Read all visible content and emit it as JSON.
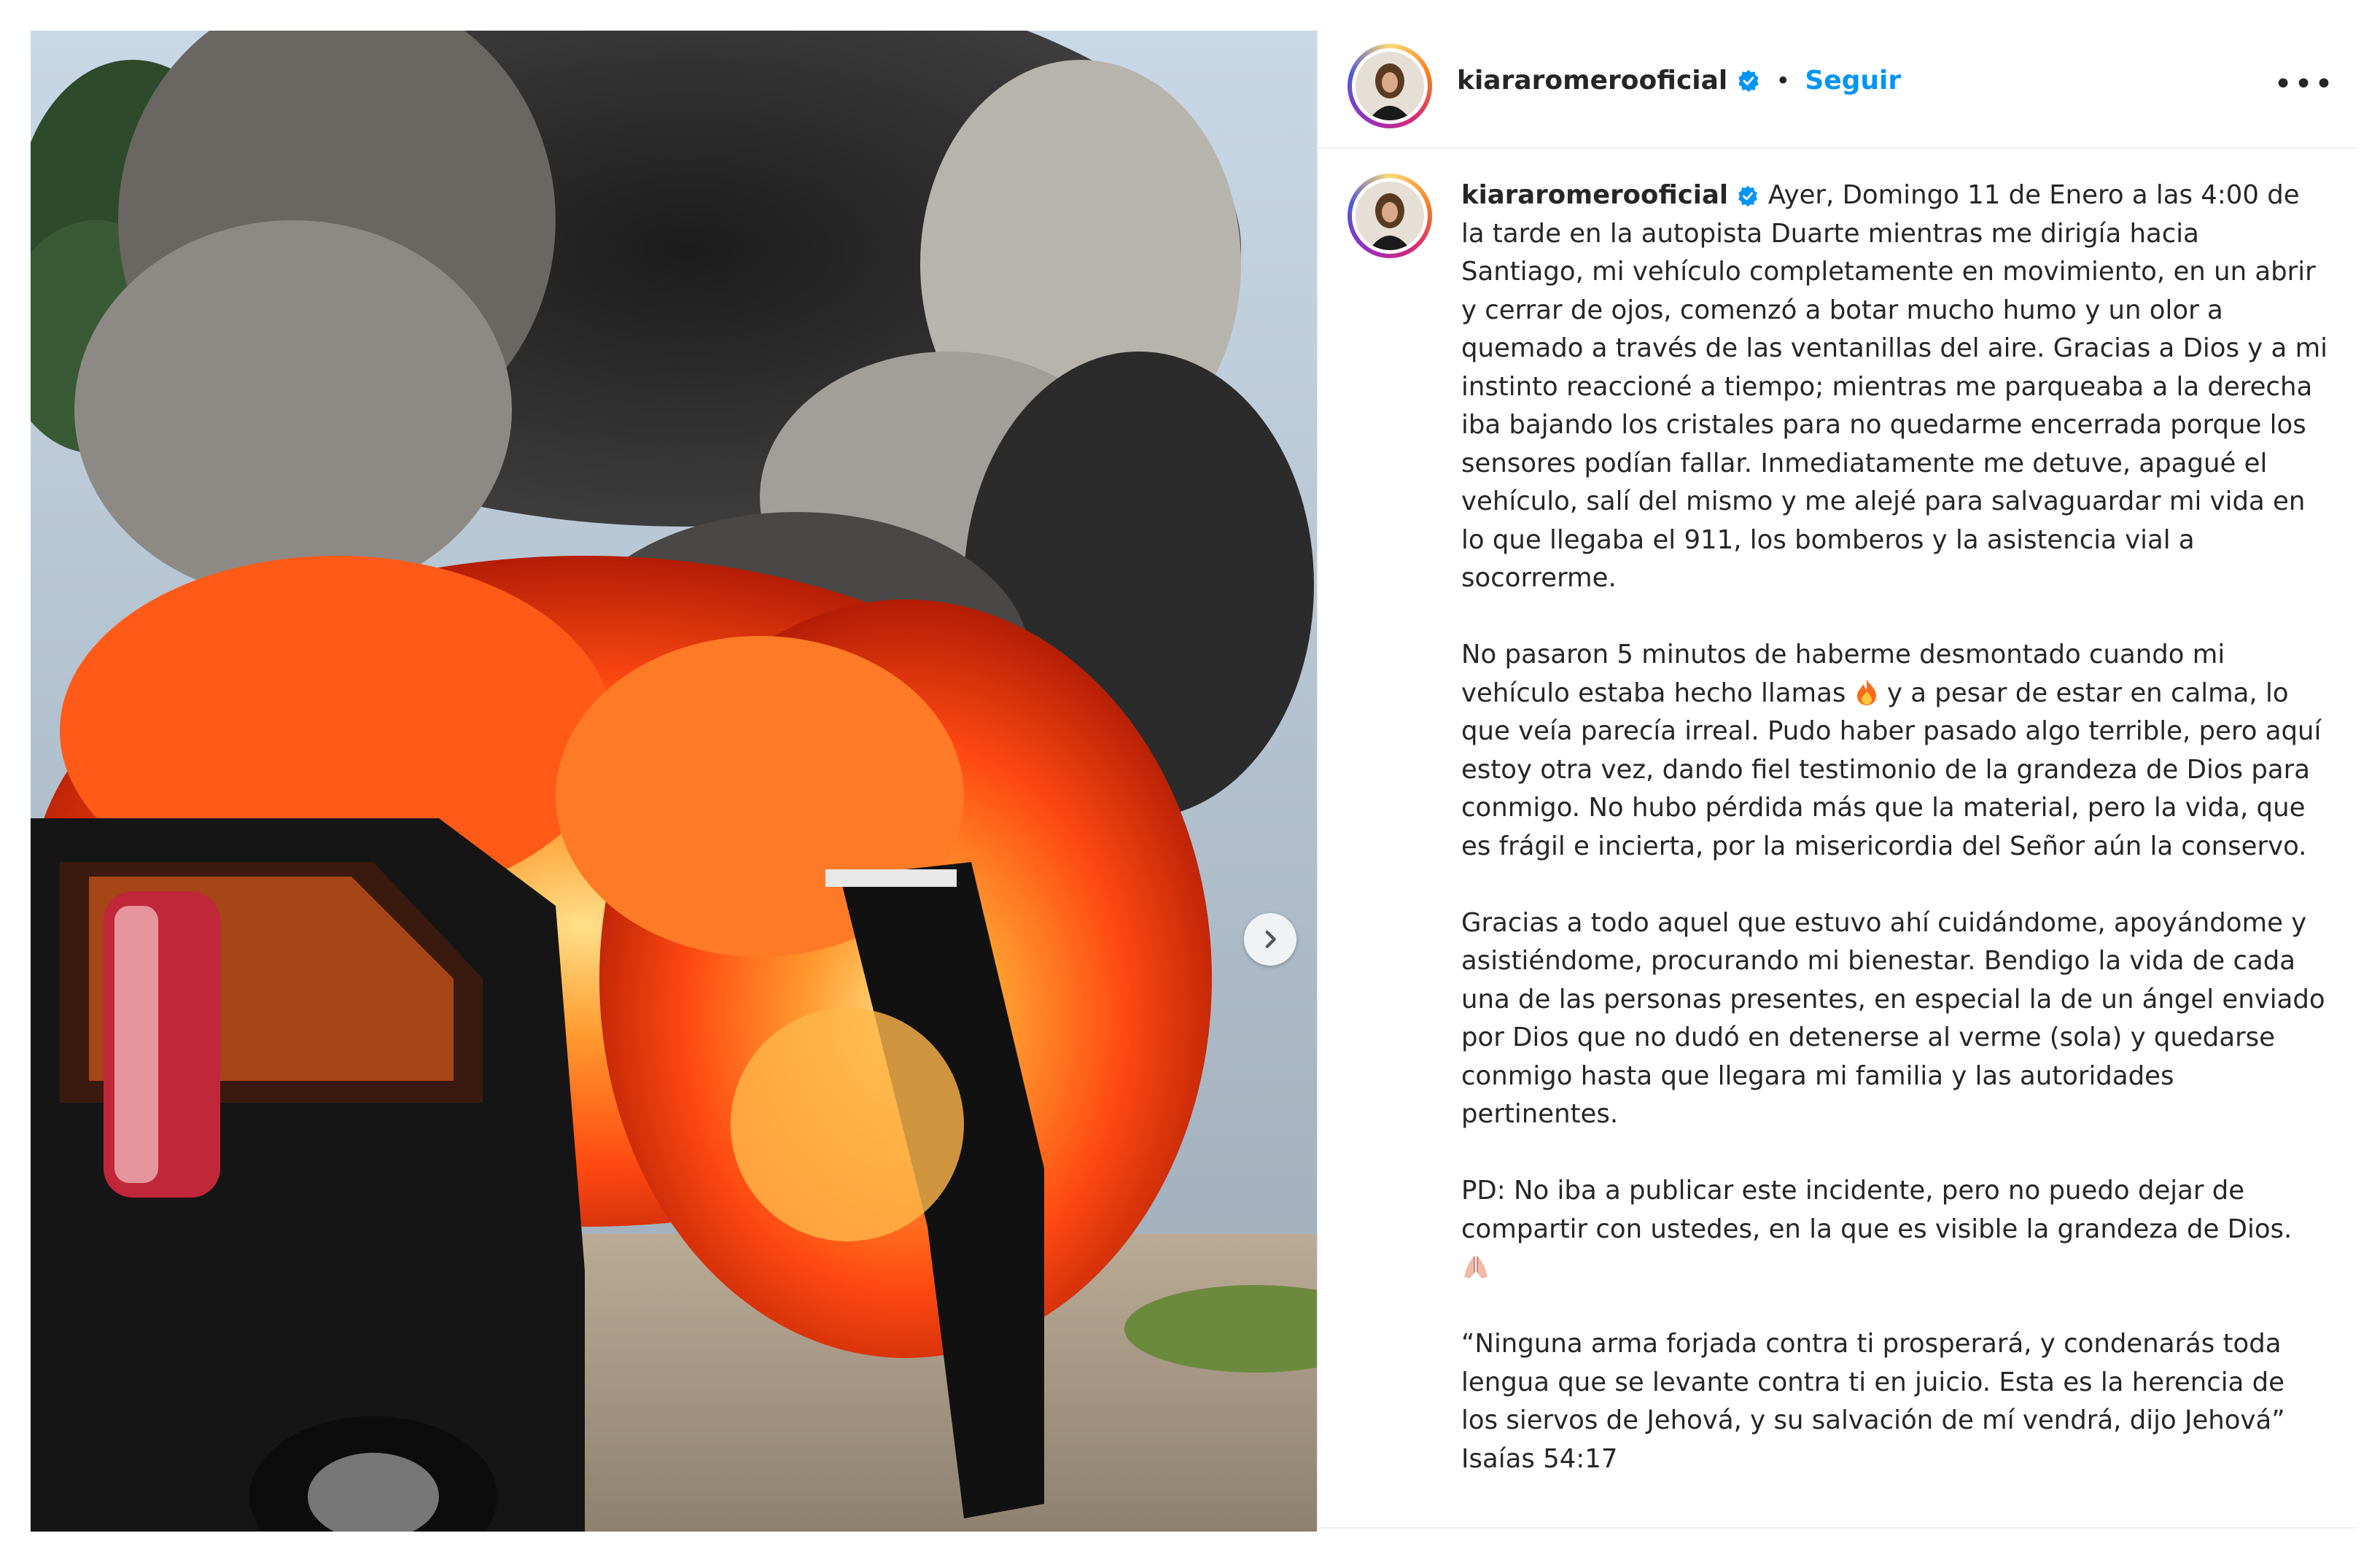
{
  "post": {
    "username": "kiararomerooficial",
    "follow_label": "Seguir",
    "separator": "•",
    "more_label": "•••"
  },
  "caption": {
    "username": "kiararomerooficial",
    "p1": "Ayer, Domingo 11 de Enero a las 4:00 de la tarde en la autopista Duarte mientras me dirigía hacia Santiago, mi vehículo completamente en movimiento, en un abrir y cerrar de ojos, comenzó a botar mucho humo y un olor a quemado a través de las ventanillas del aire. Gracias a Dios y a mi instinto reaccioné a tiempo; mientras me parqueaba a la derecha iba bajando los cristales para no quedarme encerrada porque los sensores podían fallar. Inmediatamente me detuve, apagué el vehículo, salí del mismo y me alejé para salvaguardar mi vida en lo que llegaba el 911, los bomberos y la asistencia vial a socorrerme.",
    "p2_before_emoji": "No pasaron 5 minutos de haberme desmontado cuando mi vehículo estaba hecho llamas",
    "p2_after_emoji": " y a pesar de estar en calma, lo que veía parecía irreal. Pudo haber pasado algo terrible, pero aquí estoy otra vez, dando fiel testimonio de la grandeza de Dios para conmigo. No hubo pérdida más que la material, pero la vida, que es frágil e incierta, por la misericordia del Señor aún la conservo.",
    "p3": "Gracias a todo aquel que estuvo ahí cuidándome, apoyándome y asistiéndome, procurando mi bienestar. Bendigo la vida de cada una de las personas presentes, en especial la de un ángel enviado por Dios que no dudó en detenerse al verme (sola) y quedarse conmigo hasta que llegara mi familia y las autoridades pertinentes.",
    "p4": "PD: No iba a publicar este incidente, pero no puedo dejar de compartir con ustedes, en la que es visible la grandeza de Dios.",
    "p5": "“Ninguna arma forjada contra ti prosperará, y condenarás toda lengua que se levante contra ti en juicio. Esta es la herencia de los siervos de Jehová, y su salvación de mí vendrá, dijo Jehová”",
    "p5_ref": "Isaías 54:17"
  },
  "icons": {
    "verified": "verified-badge-icon",
    "next": "chevron-right-icon",
    "fire": "fire-emoji",
    "pray": "praying-hands-emoji"
  },
  "colors": {
    "follow": "#0095f6",
    "verified": "#0095f6",
    "text": "#262626",
    "divider": "#efefef"
  }
}
